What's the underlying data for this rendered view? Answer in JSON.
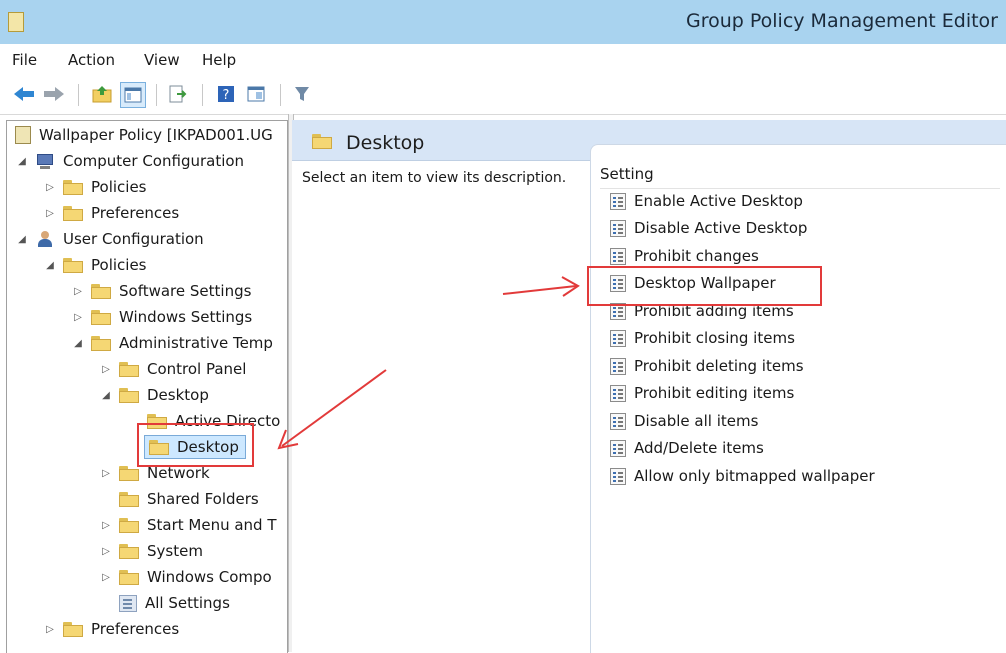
{
  "window": {
    "title": "Group Policy Management Editor"
  },
  "menu": {
    "file": "File",
    "action": "Action",
    "view": "View",
    "help": "Help"
  },
  "toolbar": {
    "icons": [
      "back-icon",
      "forward-icon",
      "up-folder-icon",
      "show-hide-tree-icon",
      "export-icon",
      "help-icon",
      "properties-icon",
      "filter-icon"
    ]
  },
  "tree": {
    "root": "Wallpaper Policy [IKPAD001.UG",
    "computer_config": "Computer Configuration",
    "cc_policies": "Policies",
    "cc_preferences": "Preferences",
    "user_config": "User Configuration",
    "uc_policies": "Policies",
    "software_settings": "Software Settings",
    "windows_settings": "Windows Settings",
    "admin_templates": "Administrative Temp",
    "control_panel": "Control Panel",
    "desktop": "Desktop",
    "active_directory": "Active Directo",
    "desktop_child": "Desktop",
    "network": "Network",
    "shared_folders": "Shared Folders",
    "start_menu": "Start Menu and T",
    "system": "System",
    "windows_components": "Windows Compo",
    "all_settings": "All Settings",
    "uc_preferences": "Preferences"
  },
  "right": {
    "title": "Desktop",
    "description": "Select an item to view its description.",
    "column_header": "Setting",
    "settings": [
      "Enable Active Desktop",
      "Disable Active Desktop",
      "Prohibit changes",
      "Desktop Wallpaper",
      "Prohibit adding items",
      "Prohibit closing items",
      "Prohibit deleting items",
      "Prohibit editing items",
      "Disable all items",
      "Add/Delete items",
      "Allow only bitmapped wallpaper"
    ]
  },
  "colors": {
    "title_bar": "#a9d3ef",
    "header_band": "#d7e5f6",
    "annotation": "#e23a3a",
    "selection": "#cde8ff"
  }
}
